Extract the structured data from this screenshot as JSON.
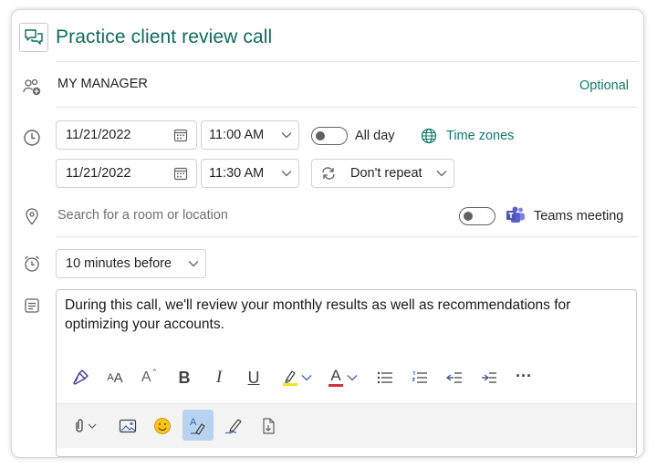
{
  "event": {
    "title": "Practice client review call",
    "attendee": "MY MANAGER",
    "optional_label": "Optional",
    "start_date": "11/21/2022",
    "start_time": "11:00 AM",
    "end_date": "11/21/2022",
    "end_time": "11:30 AM",
    "all_day_label": "All day",
    "time_zones_label": "Time zones",
    "repeat_label": "Don't repeat",
    "location_placeholder": "Search for a room or location",
    "teams_label": "Teams meeting",
    "reminder": "10 minutes before",
    "body_text": "During this call, we'll review your monthly results as well as recommendations for optimizing your accounts."
  },
  "toolbar": {
    "bold_glyph": "B",
    "italic_glyph": "I",
    "underline_glyph": "U",
    "more_glyph": "···",
    "font_size_glyph": "A",
    "grow_glyph": "A",
    "font_color_glyph": "A"
  },
  "colors": {
    "accent": "#0f6b5e",
    "highlight": "#f5e51b",
    "font_color": "#d13438",
    "teams": "#5b5fc7",
    "toggle_off": "#616161"
  },
  "toggles": {
    "all_day": false,
    "teams_meeting": false
  }
}
